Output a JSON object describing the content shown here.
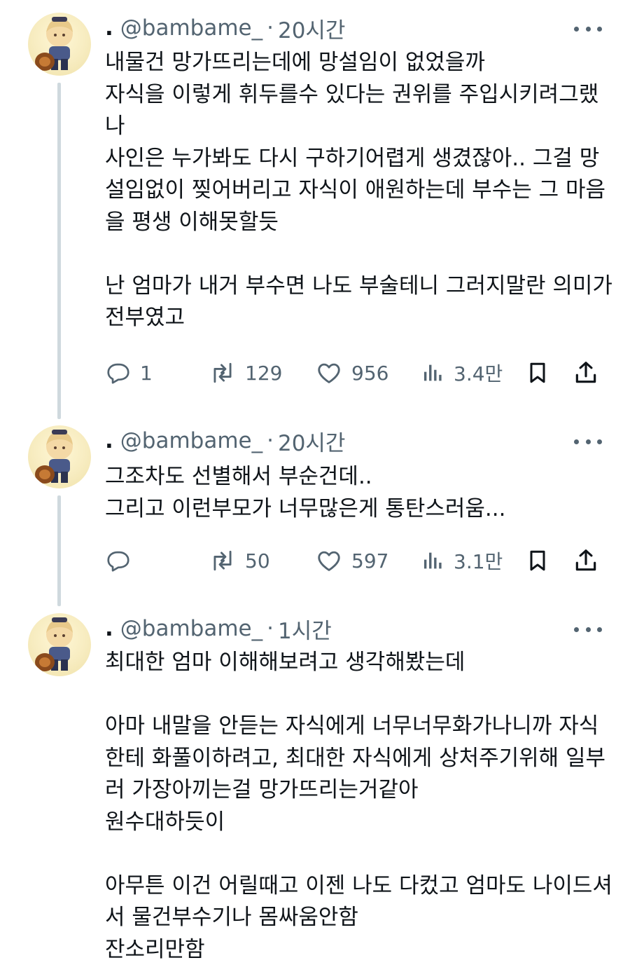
{
  "tweets": [
    {
      "handle": "@bambame_",
      "dot": "·",
      "time": "20시간",
      "text": "내물건 망가뜨리는데에 망설임이 없었을까\n자식을 이렇게 휘두를수 있다는 권위를 주입시키려그랬나\n사인은 누가봐도 다시 구하기어렵게 생겼잖아.. 그걸 망설임없이 찢어버리고 자식이 애원하는데 부수는 그 마음을 평생 이해못할듯\n\n난 엄마가 내거 부수면 나도 부술테니 그러지말란 의미가 전부였고",
      "replies": "1",
      "retweets": "129",
      "likes": "956",
      "views": "3.4만"
    },
    {
      "handle": "@bambame_",
      "dot": "·",
      "time": "20시간",
      "text": "그조차도 선별해서 부순건데..\n그리고 이런부모가 너무많은게 통탄스러움...",
      "replies": "",
      "retweets": "50",
      "likes": "597",
      "views": "3.1만"
    },
    {
      "handle": "@bambame_",
      "dot": "·",
      "time": "1시간",
      "text": "최대한 엄마 이해해보려고 생각해봤는데\n\n아마 내말을 안듣는 자식에게 너무너무화가나니까 자식한테 화풀이하려고, 최대한 자식에게 상처주기위해 일부러 가장아끼는걸 망가뜨리는거같아\n원수대하듯이\n\n아무튼 이건 어릴때고 이젠 나도 다컸고 엄마도 나이드셔서 물건부수기나 몸싸움안함\n잔소리만함"
    }
  ],
  "icons": {
    "reply": "reply-bubble-icon",
    "retweet": "retweet-arrows-icon",
    "like": "heart-icon",
    "views": "bar-chart-icon",
    "bookmark": "bookmark-icon",
    "share": "share-upload-icon",
    "more": "more-dots-icon"
  },
  "colors": {
    "text": "#0f1419",
    "secondary": "#536471",
    "thread_line": "#cfd9de",
    "background": "#ffffff"
  }
}
